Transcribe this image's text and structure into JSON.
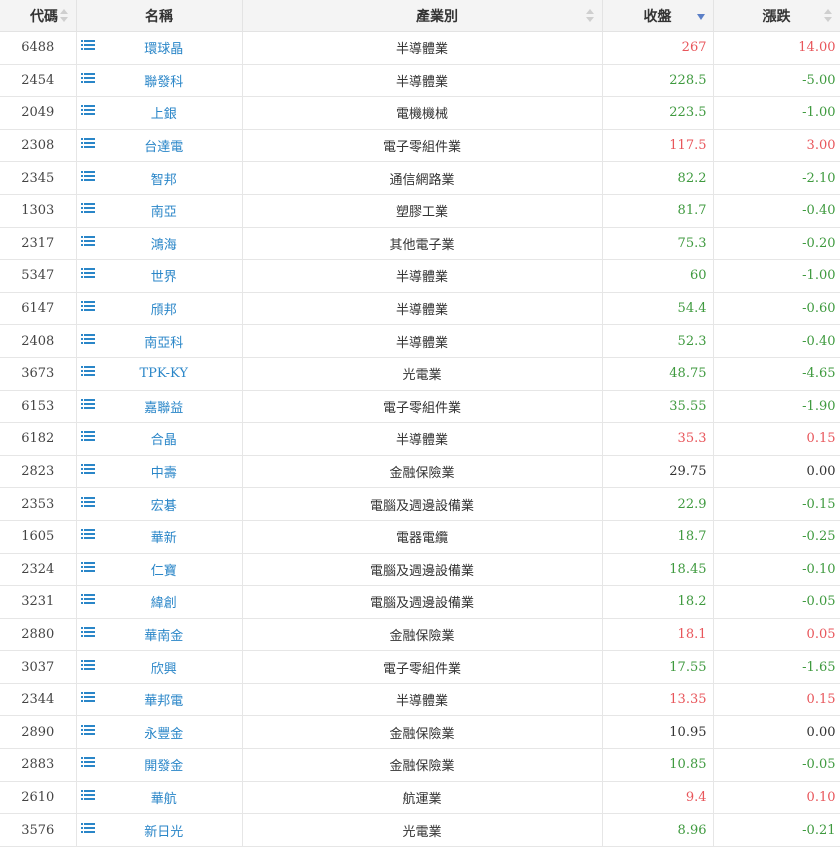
{
  "header": {
    "code": "代碼",
    "name": "名稱",
    "industry": "產業別",
    "close": "收盤",
    "change": "漲跌"
  },
  "colors": {
    "up": "#e8565b",
    "down": "#3f9a3f",
    "flat": "#333333",
    "link": "#2a86c8"
  },
  "rows": [
    {
      "code": "6488",
      "name": "環球晶",
      "industry": "半導體業",
      "close": "267",
      "change": "14.00",
      "trend": "up"
    },
    {
      "code": "2454",
      "name": "聯發科",
      "industry": "半導體業",
      "close": "228.5",
      "change": "-5.00",
      "trend": "down"
    },
    {
      "code": "2049",
      "name": "上銀",
      "industry": "電機機械",
      "close": "223.5",
      "change": "-1.00",
      "trend": "down"
    },
    {
      "code": "2308",
      "name": "台達電",
      "industry": "電子零組件業",
      "close": "117.5",
      "change": "3.00",
      "trend": "up"
    },
    {
      "code": "2345",
      "name": "智邦",
      "industry": "通信網路業",
      "close": "82.2",
      "change": "-2.10",
      "trend": "down"
    },
    {
      "code": "1303",
      "name": "南亞",
      "industry": "塑膠工業",
      "close": "81.7",
      "change": "-0.40",
      "trend": "down"
    },
    {
      "code": "2317",
      "name": "鴻海",
      "industry": "其他電子業",
      "close": "75.3",
      "change": "-0.20",
      "trend": "down"
    },
    {
      "code": "5347",
      "name": "世界",
      "industry": "半導體業",
      "close": "60",
      "change": "-1.00",
      "trend": "down"
    },
    {
      "code": "6147",
      "name": "頎邦",
      "industry": "半導體業",
      "close": "54.4",
      "change": "-0.60",
      "trend": "down"
    },
    {
      "code": "2408",
      "name": "南亞科",
      "industry": "半導體業",
      "close": "52.3",
      "change": "-0.40",
      "trend": "down"
    },
    {
      "code": "3673",
      "name": "TPK-KY",
      "industry": "光電業",
      "close": "48.75",
      "change": "-4.65",
      "trend": "down"
    },
    {
      "code": "6153",
      "name": "嘉聯益",
      "industry": "電子零組件業",
      "close": "35.55",
      "change": "-1.90",
      "trend": "down"
    },
    {
      "code": "6182",
      "name": "合晶",
      "industry": "半導體業",
      "close": "35.3",
      "change": "0.15",
      "trend": "up"
    },
    {
      "code": "2823",
      "name": "中壽",
      "industry": "金融保險業",
      "close": "29.75",
      "change": "0.00",
      "trend": "flat"
    },
    {
      "code": "2353",
      "name": "宏碁",
      "industry": "電腦及週邊設備業",
      "close": "22.9",
      "change": "-0.15",
      "trend": "down"
    },
    {
      "code": "1605",
      "name": "華新",
      "industry": "電器電纜",
      "close": "18.7",
      "change": "-0.25",
      "trend": "down"
    },
    {
      "code": "2324",
      "name": "仁寶",
      "industry": "電腦及週邊設備業",
      "close": "18.45",
      "change": "-0.10",
      "trend": "down"
    },
    {
      "code": "3231",
      "name": "緯創",
      "industry": "電腦及週邊設備業",
      "close": "18.2",
      "change": "-0.05",
      "trend": "down"
    },
    {
      "code": "2880",
      "name": "華南金",
      "industry": "金融保險業",
      "close": "18.1",
      "change": "0.05",
      "trend": "up"
    },
    {
      "code": "3037",
      "name": "欣興",
      "industry": "電子零組件業",
      "close": "17.55",
      "change": "-1.65",
      "trend": "down"
    },
    {
      "code": "2344",
      "name": "華邦電",
      "industry": "半導體業",
      "close": "13.35",
      "change": "0.15",
      "trend": "up"
    },
    {
      "code": "2890",
      "name": "永豐金",
      "industry": "金融保險業",
      "close": "10.95",
      "change": "0.00",
      "trend": "flat"
    },
    {
      "code": "2883",
      "name": "開發金",
      "industry": "金融保險業",
      "close": "10.85",
      "change": "-0.05",
      "trend": "down"
    },
    {
      "code": "2610",
      "name": "華航",
      "industry": "航運業",
      "close": "9.4",
      "change": "0.10",
      "trend": "up"
    },
    {
      "code": "3576",
      "name": "新日光",
      "industry": "光電業",
      "close": "8.96",
      "change": "-0.21",
      "trend": "down"
    }
  ]
}
